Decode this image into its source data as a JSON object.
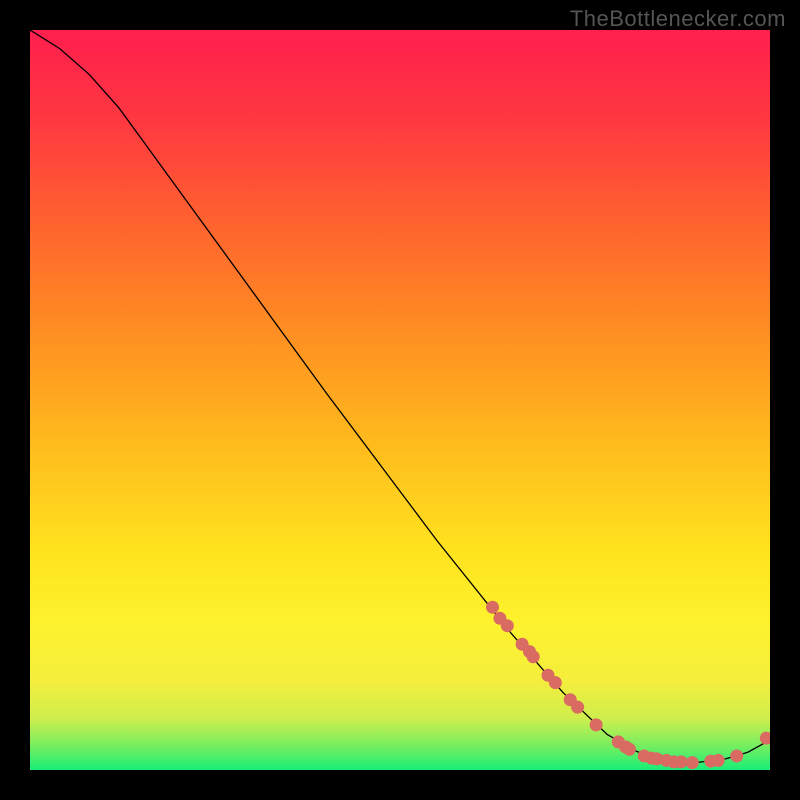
{
  "watermark": "TheBottlenecker.com",
  "chart_data": {
    "type": "line",
    "title": "",
    "xlabel": "",
    "ylabel": "",
    "xlim": [
      0,
      100
    ],
    "ylim": [
      0,
      100
    ],
    "background_gradient_id": "thermal",
    "background_gradient": [
      {
        "offset": 0.0,
        "color": "#18ee77"
      },
      {
        "offset": 0.03,
        "color": "#6fee61"
      },
      {
        "offset": 0.07,
        "color": "#cfee4d"
      },
      {
        "offset": 0.12,
        "color": "#f4ee3d"
      },
      {
        "offset": 0.2,
        "color": "#fef22d"
      },
      {
        "offset": 0.3,
        "color": "#ffe21e"
      },
      {
        "offset": 0.45,
        "color": "#ffb81d"
      },
      {
        "offset": 0.6,
        "color": "#ff8c22"
      },
      {
        "offset": 0.75,
        "color": "#ff5f30"
      },
      {
        "offset": 0.88,
        "color": "#ff3741"
      },
      {
        "offset": 1.0,
        "color": "#ff1f4e"
      }
    ],
    "curve": {
      "color": "#000000",
      "width": 1.3,
      "points": [
        {
          "x": 0.0,
          "y": 100.0
        },
        {
          "x": 4.0,
          "y": 97.5
        },
        {
          "x": 8.0,
          "y": 94.0
        },
        {
          "x": 12.0,
          "y": 89.5
        },
        {
          "x": 16.0,
          "y": 84.0
        },
        {
          "x": 20.0,
          "y": 78.5
        },
        {
          "x": 28.0,
          "y": 67.5
        },
        {
          "x": 40.0,
          "y": 51.0
        },
        {
          "x": 55.0,
          "y": 31.0
        },
        {
          "x": 65.0,
          "y": 18.5
        },
        {
          "x": 72.0,
          "y": 10.5
        },
        {
          "x": 78.0,
          "y": 4.8
        },
        {
          "x": 82.0,
          "y": 2.5
        },
        {
          "x": 86.0,
          "y": 1.3
        },
        {
          "x": 90.0,
          "y": 1.0
        },
        {
          "x": 94.0,
          "y": 1.5
        },
        {
          "x": 97.0,
          "y": 2.4
        },
        {
          "x": 99.0,
          "y": 3.5
        },
        {
          "x": 100.0,
          "y": 4.8
        }
      ]
    },
    "marker_series": {
      "color": "#d96b62",
      "radius": 6.5,
      "points": [
        {
          "x": 62.5,
          "y": 22.0
        },
        {
          "x": 63.5,
          "y": 20.5
        },
        {
          "x": 64.5,
          "y": 19.5
        },
        {
          "x": 66.5,
          "y": 17.0
        },
        {
          "x": 67.5,
          "y": 16.0
        },
        {
          "x": 68.0,
          "y": 15.3
        },
        {
          "x": 70.0,
          "y": 12.8
        },
        {
          "x": 71.0,
          "y": 11.8
        },
        {
          "x": 73.0,
          "y": 9.5
        },
        {
          "x": 74.0,
          "y": 8.5
        },
        {
          "x": 76.5,
          "y": 6.1
        },
        {
          "x": 79.5,
          "y": 3.8
        },
        {
          "x": 80.5,
          "y": 3.1
        },
        {
          "x": 81.0,
          "y": 2.8
        },
        {
          "x": 83.0,
          "y": 1.9
        },
        {
          "x": 84.0,
          "y": 1.6
        },
        {
          "x": 84.7,
          "y": 1.5
        },
        {
          "x": 86.0,
          "y": 1.3
        },
        {
          "x": 87.0,
          "y": 1.1
        },
        {
          "x": 88.0,
          "y": 1.1
        },
        {
          "x": 89.5,
          "y": 1.0
        },
        {
          "x": 92.0,
          "y": 1.2
        },
        {
          "x": 93.0,
          "y": 1.3
        },
        {
          "x": 95.5,
          "y": 1.9
        },
        {
          "x": 99.5,
          "y": 4.3
        }
      ]
    }
  }
}
